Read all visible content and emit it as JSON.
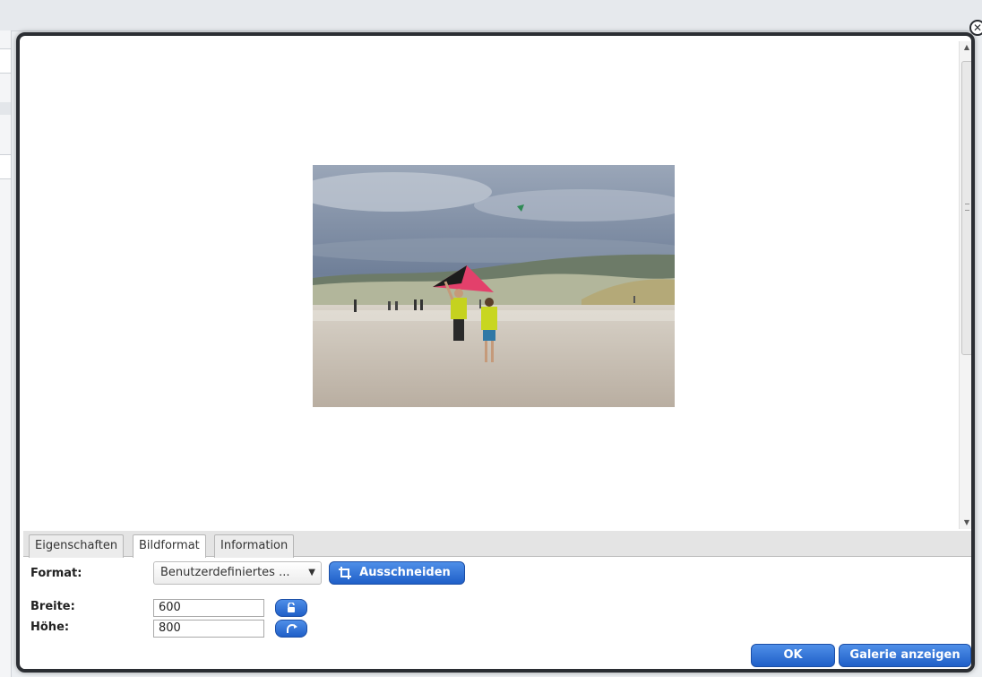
{
  "dialog": {
    "close_symbol": "✕"
  },
  "preview": {
    "image_alt": "Beach photo: two people flying a red and black kite on a windy beach"
  },
  "tabs": [
    {
      "label": "Eigenschaften",
      "active": false
    },
    {
      "label": "Bildformat",
      "active": true
    },
    {
      "label": "Information",
      "active": false
    }
  ],
  "format": {
    "label": "Format:",
    "selected": "Benutzerdefiniertes ...",
    "crop_button": "Ausschneiden"
  },
  "size": {
    "width_label": "Breite:",
    "width_value": "600",
    "height_label": "Höhe:",
    "height_value": "800"
  },
  "footer": {
    "ok_button": "OK",
    "gallery_button": "Galerie anzeigen"
  },
  "icons": {
    "close": "close-icon",
    "crop": "crop-icon",
    "lock": "unlock-icon",
    "rotate": "rotate-icon",
    "dropdown": "chevron-down-icon"
  },
  "colors": {
    "button_blue": "#2a6fd8",
    "dialog_border": "#2b2e33",
    "tab_bg": "#e4e4e4"
  }
}
